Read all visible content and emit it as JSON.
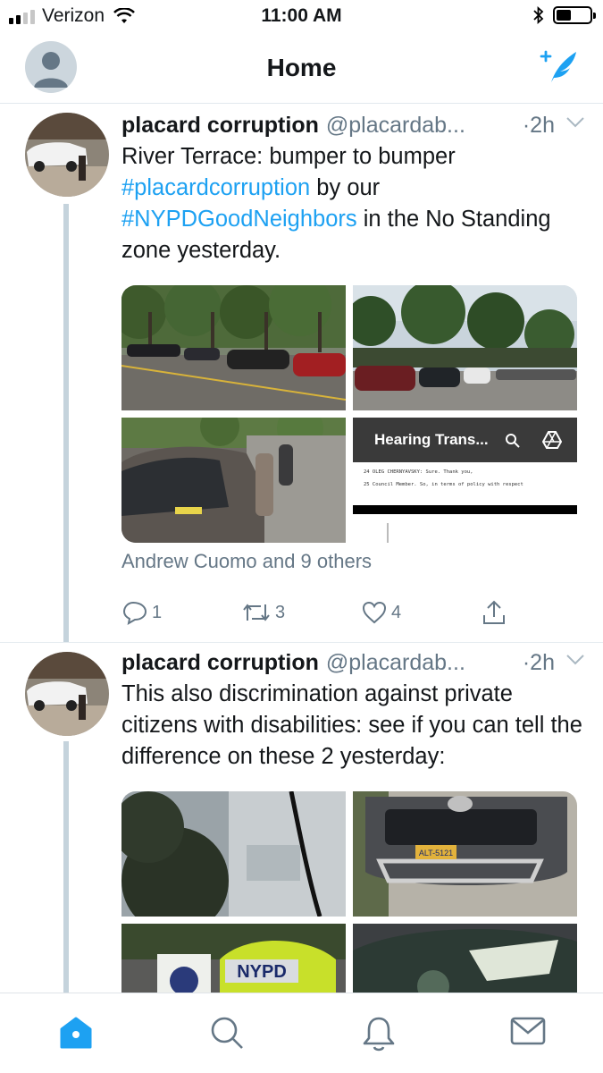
{
  "status_bar": {
    "carrier": "Verizon",
    "time": "11:00 AM",
    "battery_level": 0.45
  },
  "header": {
    "title": "Home",
    "icons": [
      "profile-avatar",
      "compose-tweet-icon"
    ]
  },
  "tweets": [
    {
      "name": "placard corruption",
      "handle": "@placardab...",
      "time": "·2h",
      "text_parts": [
        "River Terrace: bumper to bumper ",
        "#placardcorruption",
        " by our ",
        "#NYPDGoodNeighbors",
        " in the No Standing zone yesterday."
      ],
      "document_preview_title": "Hearing Trans...",
      "document_lines": [
        "24        OLEG CHERNYAVSKY: Sure. Thank you,",
        "25   Council Member. So, in terms of policy with respect"
      ],
      "document_line_numbers": [
        "24",
        "25"
      ],
      "liked_by": "Andrew Cuomo and 9 others",
      "replies": "1",
      "retweets": "3",
      "likes": "4"
    },
    {
      "name": "placard corruption",
      "handle": "@placardab...",
      "time": "·2h",
      "text": "This also discrimination against private citizens with disabilities: see if you can tell the difference on these 2 yesterday:",
      "plate_text": "ALT-5121",
      "badge_text": "NYPD"
    }
  ],
  "colors": {
    "accent": "#1da1f2",
    "secondary_text": "#657786",
    "thread_line": "#c5d3dc"
  },
  "tab_bar": {
    "tabs": [
      "home-icon",
      "search-icon",
      "notifications-icon",
      "messages-icon"
    ],
    "active": "home-icon"
  }
}
